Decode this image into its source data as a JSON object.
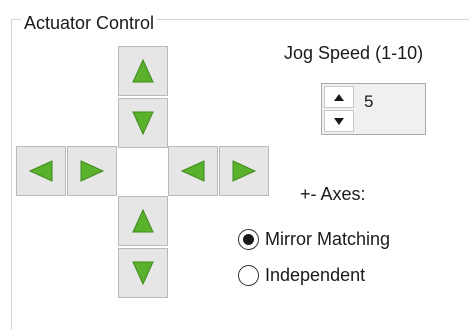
{
  "group": {
    "title": "Actuator Control"
  },
  "jog": {
    "label": "Jog Speed (1-10)",
    "value": "5"
  },
  "axes": {
    "label": "+- Axes:"
  },
  "radios": {
    "mirror": {
      "label": "Mirror Matching",
      "checked": true
    },
    "independent": {
      "label": "Independent",
      "checked": false
    }
  },
  "icons": {
    "arrow_color": "#5ab12c",
    "arrow_outline": "#3f8a1c"
  }
}
